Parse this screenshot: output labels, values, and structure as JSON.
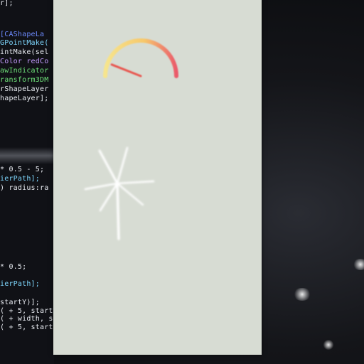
{
  "code_editor": {
    "lines": [
      {
        "text": "r];",
        "color": "white"
      },
      {
        "text": "[CAShapeLa",
        "color": "blue"
      },
      {
        "text": "GPointMake(",
        "color": "cyan"
      },
      {
        "text": "intMake(sel",
        "color": "white"
      },
      {
        "text": "Color redCo",
        "color": "purple"
      },
      {
        "text": "awIndicator",
        "color": "green"
      },
      {
        "text": "ransform3DM",
        "color": "green"
      },
      {
        "text": "rShapeLayer",
        "color": "white"
      },
      {
        "text": "hapeLayer];",
        "color": "white"
      },
      {
        "text": "* 0.5 - 5;",
        "color": "white"
      },
      {
        "text": "ierPath];",
        "color": "cyan"
      },
      {
        "text": ") radius:ra",
        "color": "white"
      },
      {
        "text": "* 0.5;",
        "color": "white"
      },
      {
        "text": "ierPath];",
        "color": "cyan"
      },
      {
        "text": "startY)];",
        "color": "white"
      },
      {
        "text": "( + 5, start",
        "color": "white"
      },
      {
        "text": "( + width, s",
        "color": "white"
      },
      {
        "text": "( + 5, start",
        "color": "white"
      }
    ]
  },
  "simulator": {
    "background_color": "#d7dcd3",
    "gauge": {
      "value": 0.12,
      "arc_colors": [
        "#f6e58d",
        "#f7c86b",
        "#f08a6c",
        "#ea5a6a"
      ],
      "needle_color": "#e8564f"
    },
    "sparkle_color": "#ffffff"
  }
}
